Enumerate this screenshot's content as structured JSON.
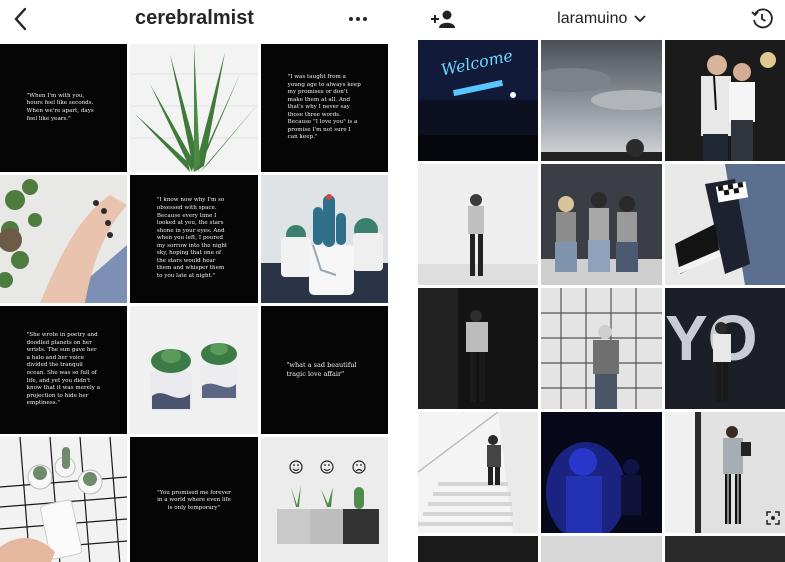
{
  "left_profile": {
    "username": "cerebralmist",
    "back_icon": "chevron-left-icon",
    "more_icon": "more-horizontal-icon",
    "quotes": {
      "q1": "\"When I'm with you, hours feel like seconds. When we're apart, days feel like years.\"",
      "q2": "\"I was taught from a young age to always keep my promises or don't make them at all. And that's why I never say those three words. Because \"I love you\" is a promise I'm not sure I can keep.\"",
      "q3": "\"I know now why I'm so obsessed with space. Because every time I looked at you, the stars shone in your eyes. And when you left, I poured my sorrow into the night sky, hoping that one of the stars would hear them and whisper them to you late at night.\"",
      "q4": "\"She wrote in poetry and doodled planets on her wrists. The sun gave her a halo and her voice divided the tranquil ocean. She was so full of life, and yet you didn't know that it was merely a projection to hide her emptiness.\"",
      "q5": "\"what a sad beautiful tragic love affair\"",
      "q6": "\"You promised me forever in a world where even life is only temporary\""
    }
  },
  "right_profile": {
    "username": "laramuino",
    "add_user_icon": "add-person-icon",
    "dropdown_icon": "chevron-down-icon",
    "history_icon": "history-clock-icon",
    "neon_sign": "Welcome",
    "wall_letters": "YO"
  }
}
